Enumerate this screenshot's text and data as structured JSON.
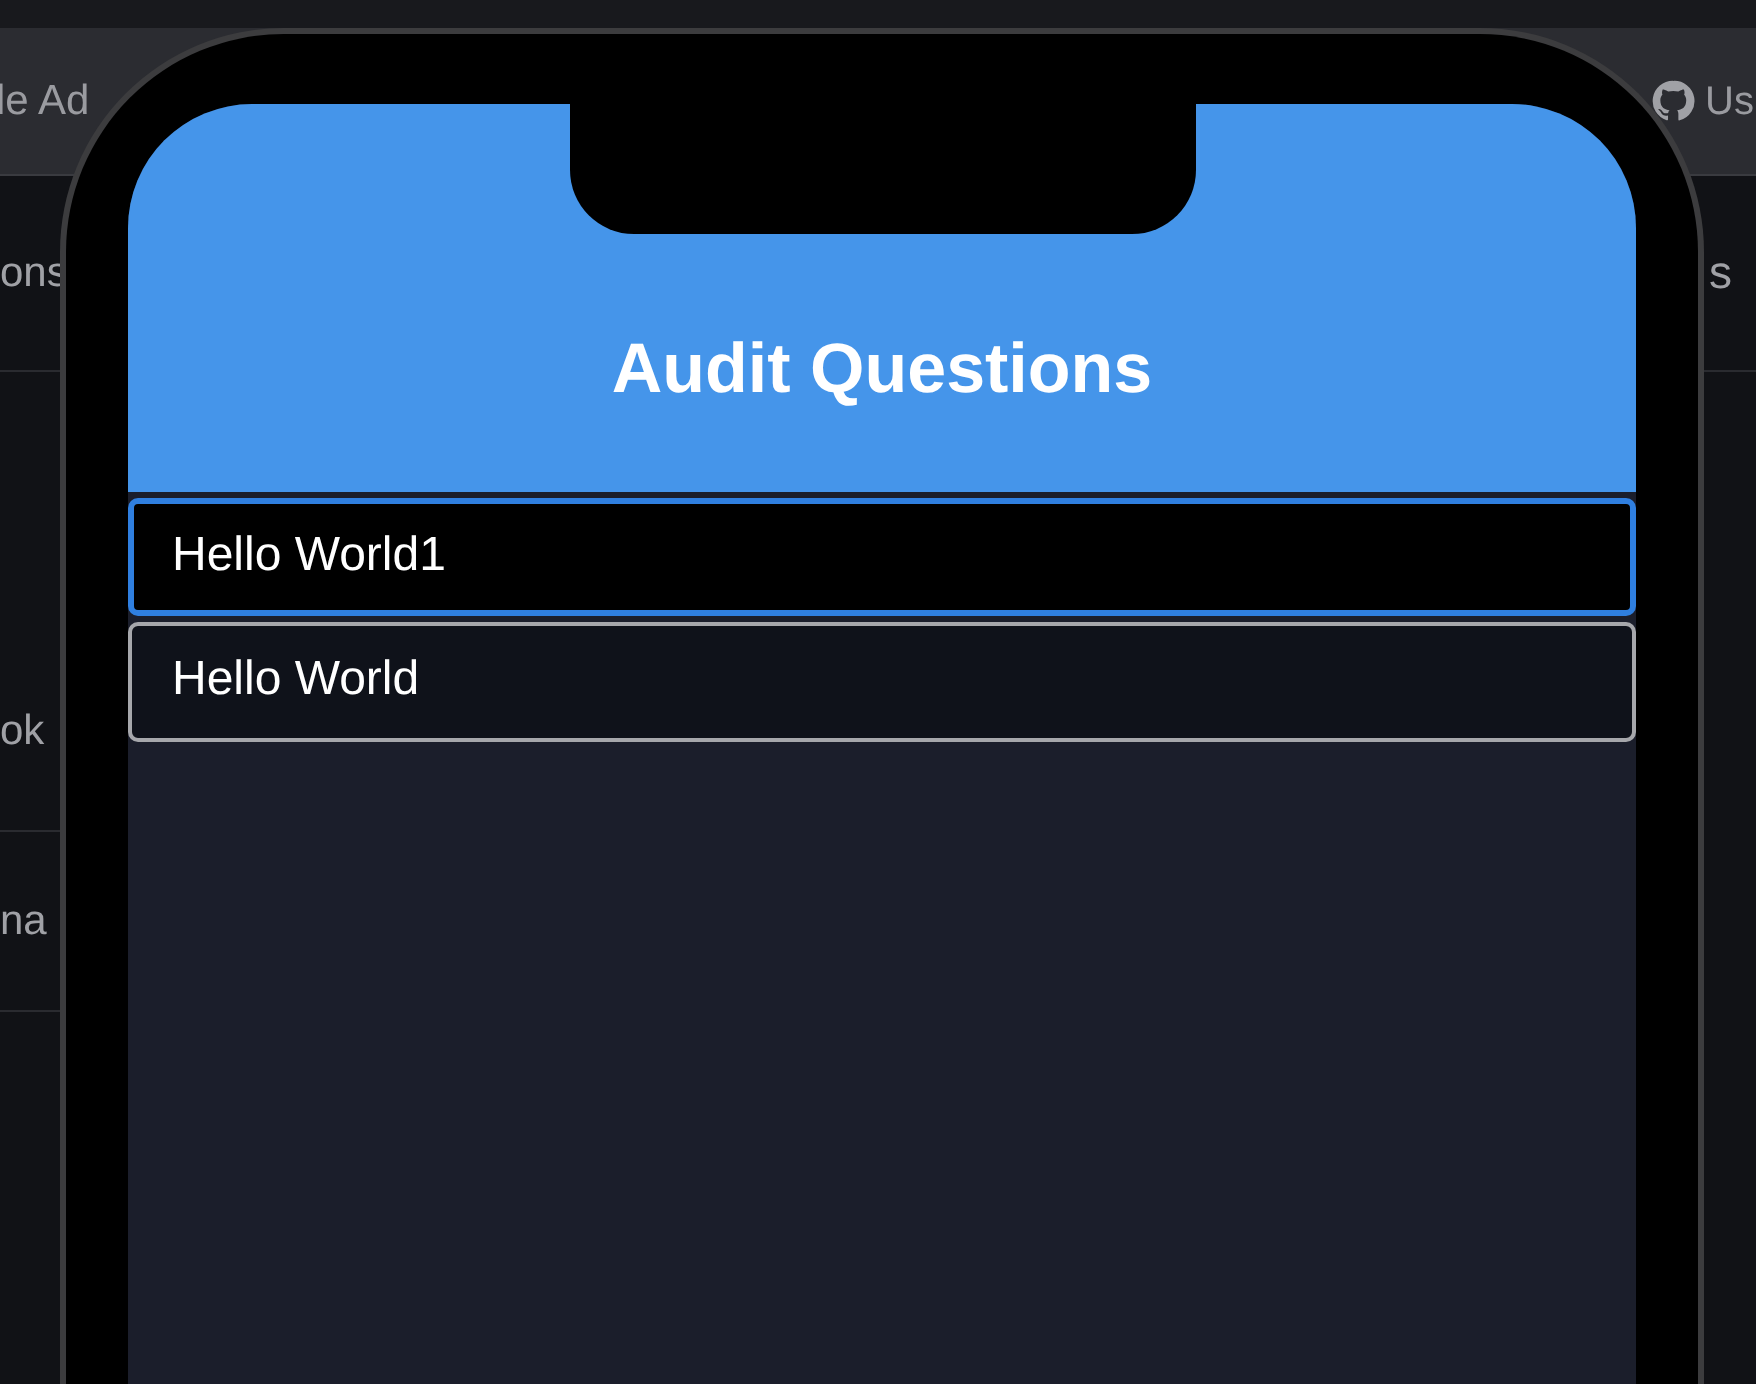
{
  "background_window": {
    "toolbar_left_text": "le Ad",
    "toolbar_right_text": "Us",
    "left_labels": [
      "ons",
      "ok",
      "na"
    ],
    "right_labels": [
      "s"
    ]
  },
  "app": {
    "title": "Audit Questions",
    "items": [
      {
        "label": "Hello World1",
        "selected": true
      },
      {
        "label": "Hello World",
        "selected": false
      }
    ]
  }
}
